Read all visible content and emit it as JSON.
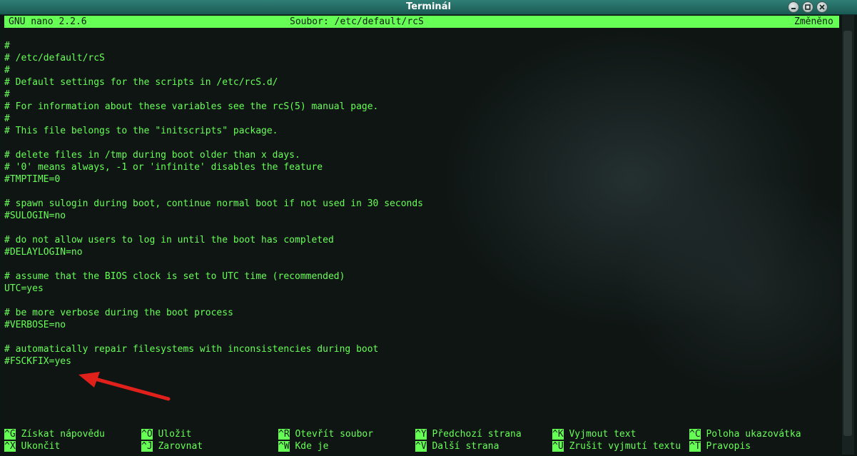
{
  "window": {
    "title": "Terminál"
  },
  "nano": {
    "version": "GNU nano 2.2.6",
    "file": "Soubor: /etc/default/rcS",
    "state": "Změněno"
  },
  "lines": [
    "#",
    "# /etc/default/rcS",
    "#",
    "# Default settings for the scripts in /etc/rcS.d/",
    "#",
    "# For information about these variables see the rcS(5) manual page.",
    "#",
    "# This file belongs to the \"initscripts\" package.",
    "",
    "# delete files in /tmp during boot older than x days.",
    "# '0' means always, -1 or 'infinite' disables the feature",
    "#TMPTIME=0",
    "",
    "# spawn sulogin during boot, continue normal boot if not used in 30 seconds",
    "#SULOGIN=no",
    "",
    "# do not allow users to log in until the boot has completed",
    "#DELAYLOGIN=no",
    "",
    "# assume that the BIOS clock is set to UTC time (recommended)",
    "UTC=yes",
    "",
    "# be more verbose during the boot process",
    "#VERBOSE=no",
    "",
    "# automatically repair filesystems with inconsistencies during boot",
    "#FSCKFIX=yes"
  ],
  "shortcuts": [
    {
      "key": "^G",
      "label": "Získat nápovědu"
    },
    {
      "key": "^O",
      "label": "Uložit"
    },
    {
      "key": "^R",
      "label": "Otevřít soubor"
    },
    {
      "key": "^Y",
      "label": "Předchozí strana"
    },
    {
      "key": "^K",
      "label": "Vyjmout text"
    },
    {
      "key": "^C",
      "label": "Poloha ukazovátka"
    },
    {
      "key": "^X",
      "label": "Ukončit"
    },
    {
      "key": "^J",
      "label": "Zarovnat"
    },
    {
      "key": "^W",
      "label": "Kde je"
    },
    {
      "key": "^V",
      "label": "Další strana"
    },
    {
      "key": "^U",
      "label": "Zrušit vyjmutí textu"
    },
    {
      "key": "^T",
      "label": "Pravopis"
    }
  ],
  "colors": {
    "terminal_text": "#66ff55",
    "titlebar": "#1a5a54",
    "annotation_arrow": "#e0201a"
  }
}
